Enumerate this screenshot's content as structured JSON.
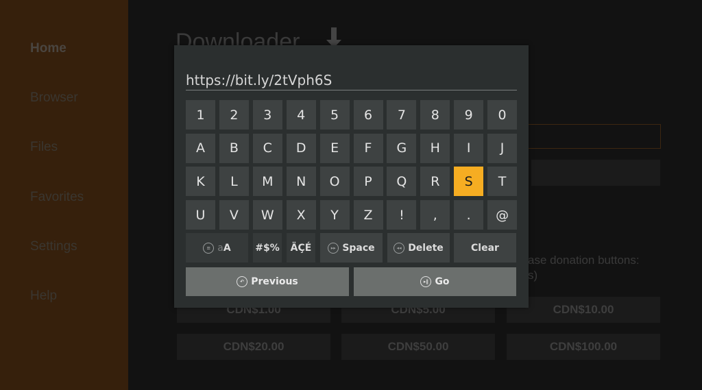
{
  "sidebar": {
    "items": [
      {
        "label": "Home",
        "active": true
      },
      {
        "label": "Browser"
      },
      {
        "label": "Files"
      },
      {
        "label": "Favorites"
      },
      {
        "label": "Settings"
      },
      {
        "label": "Help"
      }
    ]
  },
  "background": {
    "app_title": "Downloader",
    "donation_text_line1": "ase donation buttons:",
    "donation_text_line2": "s)",
    "donation_buttons": [
      "CDN$1.00",
      "CDN$5.00",
      "CDN$10.00",
      "CDN$20.00",
      "CDN$50.00",
      "CDN$100.00"
    ]
  },
  "keyboard": {
    "input_value": "https://bit.ly/2tVph6S",
    "rows": [
      [
        "1",
        "2",
        "3",
        "4",
        "5",
        "6",
        "7",
        "8",
        "9",
        "0"
      ],
      [
        "A",
        "B",
        "C",
        "D",
        "E",
        "F",
        "G",
        "H",
        "I",
        "J"
      ],
      [
        "K",
        "L",
        "M",
        "N",
        "O",
        "P",
        "Q",
        "R",
        "S",
        "T"
      ],
      [
        "U",
        "V",
        "W",
        "X",
        "Y",
        "Z",
        "!",
        ",",
        ".",
        "@"
      ]
    ],
    "focused_key": "S",
    "function_keys": {
      "case_lower": "a",
      "case_upper": "A",
      "symbols": "#$%",
      "accents": "ÄÇÉ",
      "space": "Space",
      "delete": "Delete",
      "clear": "Clear"
    },
    "previous": "Previous",
    "go": "Go",
    "accent_color": "#f6ad22"
  }
}
